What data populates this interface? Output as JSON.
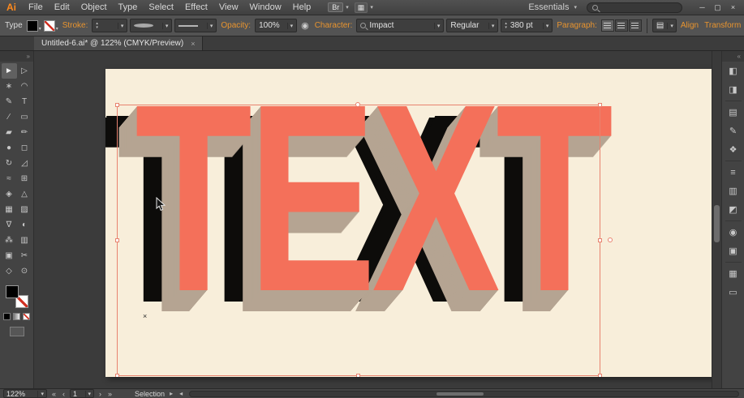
{
  "app": {
    "logo": "Ai",
    "menus": [
      "File",
      "Edit",
      "Object",
      "Type",
      "Select",
      "Effect",
      "View",
      "Window",
      "Help"
    ],
    "bridge_label": "Br",
    "workspace": "Essentials"
  },
  "control_bar": {
    "context_label": "Type",
    "stroke_label": "Stroke:",
    "opacity_label": "Opacity:",
    "opacity_value": "100%",
    "character_label": "Character:",
    "font_name": "Impact",
    "font_style": "Regular",
    "font_size": "380 pt",
    "paragraph_label": "Paragraph:",
    "align_label": "Align",
    "transform_label": "Transform"
  },
  "document": {
    "tab_title": "Untitled-6.ai* @ 122% (CMYK/Preview)"
  },
  "canvas": {
    "artwork_text": "TEXT",
    "colors": {
      "face": "#f4705a",
      "extrude": "#b5a492",
      "shadow": "#0d0c0a",
      "background": "#f8eeda",
      "selection": "#e8836f"
    }
  },
  "status_bar": {
    "zoom": "122%",
    "artboard_number": "1",
    "mode_label": "Selection"
  },
  "icons": {
    "dropdown": "▾",
    "spin_up": "▴",
    "spin_down": "▾",
    "minimize": "─",
    "restore": "▢",
    "close": "×",
    "tab_close": "×",
    "collapse_left": "«",
    "collapse_right": "»",
    "menu_flyout": "≡",
    "recolor": "◉",
    "panel_toggle": "▤",
    "arrange_docs": "▦",
    "nav_first": "«",
    "nav_prev": "‹",
    "nav_next": "›",
    "nav_last": "»",
    "scroll_left": "◂",
    "scroll_right": "▸",
    "anchor_x": "×",
    "tools": {
      "selection": "►",
      "direct_selection": "▷",
      "magic_wand": "∗",
      "lasso": "◠",
      "pen": "✎",
      "type": "T",
      "line": "∕",
      "rectangle": "▭",
      "paintbrush": "▰",
      "pencil": "✏",
      "blob_brush": "●",
      "eraser": "◻",
      "rotate": "↻",
      "scale": "◿",
      "width": "≈",
      "free_transform": "⊞",
      "shape_builder": "◈",
      "perspective_grid": "△",
      "mesh": "▦",
      "gradient": "▨",
      "eyedropper": "∇",
      "blend": "◐",
      "symbol_sprayer": "⁂",
      "column_graph": "▥",
      "artboard": "▣",
      "slice": "✂",
      "hand": "◇",
      "zoom": "⊙"
    },
    "panels": {
      "color": "◧",
      "color_guide": "◨",
      "swatches": "▤",
      "brushes": "✎",
      "symbols": "❖",
      "stroke": "≡",
      "gradient": "▥",
      "transparency": "◩",
      "appearance": "◉",
      "graphic_styles": "▣",
      "layers": "▦",
      "artboards": "▭"
    }
  }
}
